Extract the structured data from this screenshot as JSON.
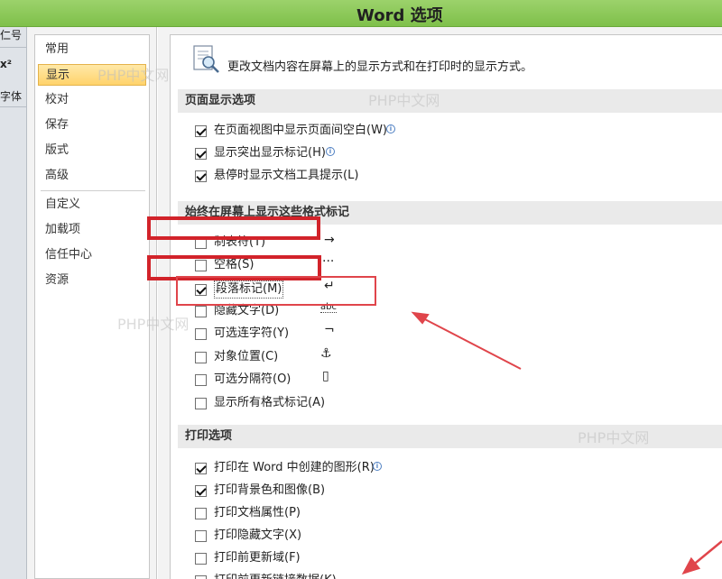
{
  "window": {
    "title": "Word 选项"
  },
  "left_strip": {
    "fragments": [
      "仁号",
      "x²",
      "字体"
    ]
  },
  "nav": {
    "items": [
      "常用",
      "显示",
      "校对",
      "保存",
      "版式",
      "高级"
    ],
    "items2": [
      "自定义",
      "加载项",
      "信任中心",
      "资源"
    ],
    "active": "显示"
  },
  "description": "更改文档内容在屏幕上的显示方式和在打印时的显示方式。",
  "sections": {
    "page_display": {
      "title": "页面显示选项",
      "options": [
        {
          "label": "在页面视图中显示页面间空白(W)",
          "checked": true,
          "info": true
        },
        {
          "label": "显示突出显示标记(H)",
          "checked": true,
          "info": true
        },
        {
          "label": "悬停时显示文档工具提示(L)",
          "checked": true,
          "info": false
        }
      ]
    },
    "format_marks": {
      "title": "始终在屏幕上显示这些格式标记",
      "options": [
        {
          "label": "制表符(T)",
          "checked": false,
          "symbol": "→"
        },
        {
          "label": "空格(S)",
          "checked": false,
          "symbol": "···"
        },
        {
          "label": "段落标记(M)",
          "checked": true,
          "symbol": "↵"
        },
        {
          "label": "隐藏文字(D)",
          "checked": false,
          "symbol": "abc"
        },
        {
          "label": "可选连字符(Y)",
          "checked": false,
          "symbol": "¬"
        },
        {
          "label": "对象位置(C)",
          "checked": false,
          "symbol": "⚓"
        },
        {
          "label": "可选分隔符(O)",
          "checked": false,
          "symbol": "▯"
        },
        {
          "label": "显示所有格式标记(A)",
          "checked": false,
          "symbol": ""
        }
      ]
    },
    "print": {
      "title": "打印选项",
      "options": [
        {
          "label": "打印在 Word 中创建的图形(R)",
          "checked": true,
          "info": true
        },
        {
          "label": "打印背景色和图像(B)",
          "checked": true,
          "info": false
        },
        {
          "label": "打印文档属性(P)",
          "checked": false,
          "info": false
        },
        {
          "label": "打印隐藏文字(X)",
          "checked": false,
          "info": false
        },
        {
          "label": "打印前更新域(F)",
          "checked": false,
          "info": false
        },
        {
          "label": "打印前更新链接数据(K)",
          "checked": false,
          "info": false
        }
      ]
    }
  },
  "watermark": "PHP中文网",
  "colors": {
    "title_bar": "#8cc85a",
    "active_nav": "#ffd36b",
    "annotation": "#d2232a"
  }
}
